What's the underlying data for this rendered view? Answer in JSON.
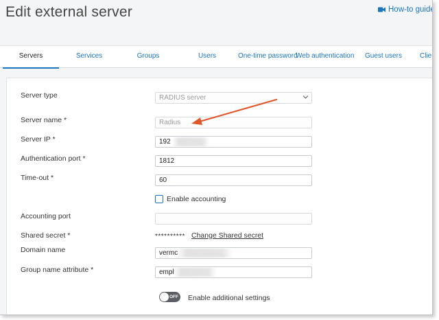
{
  "page": {
    "title": "Edit external server",
    "how_to": "How-to guides"
  },
  "tabs": [
    {
      "label": "Servers",
      "active": true
    },
    {
      "label": "Services"
    },
    {
      "label": "Groups"
    },
    {
      "label": "Users"
    },
    {
      "label": "One-time password"
    },
    {
      "label": "Web authentication"
    },
    {
      "label": "Guest users"
    },
    {
      "label": "Clie"
    }
  ],
  "form": {
    "server_type": {
      "label": "Server type",
      "value": "RADIUS server"
    },
    "server_name": {
      "label": "Server name *",
      "placeholder": "Radius"
    },
    "server_ip": {
      "label": "Server IP *",
      "value": "192"
    },
    "auth_port": {
      "label": "Authentication port *",
      "value": "1812"
    },
    "timeout": {
      "label": "Time-out *",
      "value": "60"
    },
    "enable_accounting": {
      "label": "Enable accounting",
      "checked": false
    },
    "accounting_port": {
      "label": "Accounting port",
      "value": ""
    },
    "shared_secret": {
      "label": "Shared secret *",
      "masked": "**********",
      "change_link": "Change Shared secret"
    },
    "domain_name": {
      "label": "Domain name",
      "value": "vermc"
    },
    "group_attr": {
      "label": "Group name attribute *",
      "value": "empl"
    },
    "additional": {
      "label": "Enable additional settings",
      "toggle_text": "OFF",
      "on": false
    }
  },
  "colors": {
    "accent": "#1a74c0",
    "annotation_arrow": "#e0582a"
  },
  "icons": {
    "how_to": "video-camera-icon",
    "dropdown": "chevron-down-icon"
  }
}
